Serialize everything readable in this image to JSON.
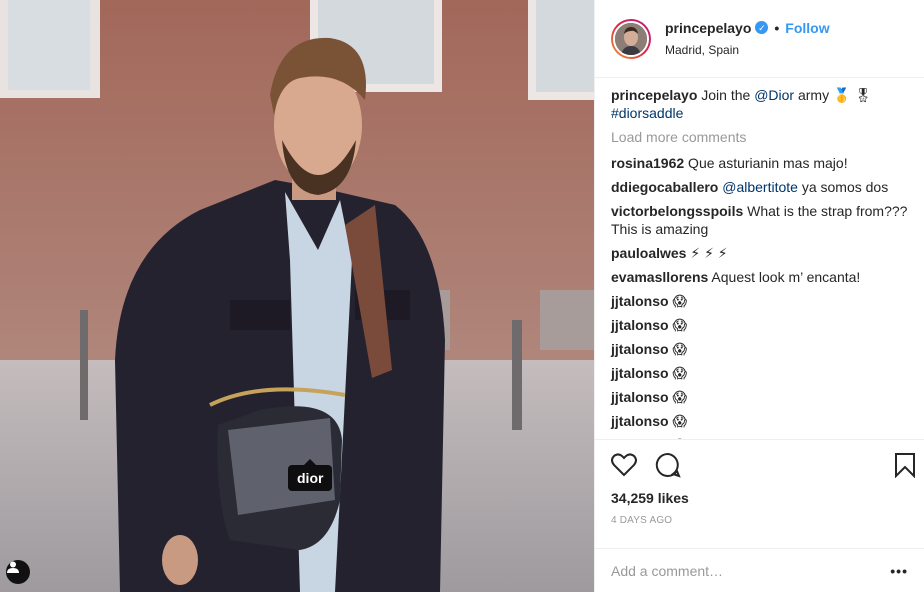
{
  "photo": {
    "tag_label": "dior"
  },
  "header": {
    "username": "princepelayo",
    "verified_mark": "✓",
    "separator": "•",
    "follow_label": "Follow",
    "location": "Madrid, Spain"
  },
  "caption": {
    "username": "princepelayo",
    "text_before": " Join the ",
    "mention": "@Dior",
    "text_after": " army 🥇 🎖",
    "hashtag": "#diorsaddle"
  },
  "load_more_label": "Load more comments",
  "comments": [
    {
      "user": "rosina1962",
      "text": " Que asturianin mas majo!"
    },
    {
      "user": "ddiegocaballero",
      "mention": " @albertitote",
      "text": " ya somos dos"
    },
    {
      "user": "victorbelongsspoils",
      "text": " What is the strap from??? This is amazing"
    },
    {
      "user": "pauloalwes",
      "text": " ⚡ ⚡ ⚡"
    },
    {
      "user": "evamasllorens",
      "text": " Aquest look m’ encanta!"
    },
    {
      "user": "jjtalonso",
      "text": " 😱"
    },
    {
      "user": "jjtalonso",
      "text": " 😱"
    },
    {
      "user": "jjtalonso",
      "text": " 😱"
    },
    {
      "user": "jjtalonso",
      "text": " 😱"
    },
    {
      "user": "jjtalonso",
      "text": " 😱"
    },
    {
      "user": "jjtalonso",
      "text": " 😱"
    },
    {
      "user": "jjtalonso",
      "text": " 😱"
    }
  ],
  "likes": "34,259 likes",
  "age": "4 DAYS AGO",
  "add_comment_placeholder": "Add a comment…",
  "more_label": "•••",
  "icons": {
    "like": "heart-icon",
    "comment": "comment-icon",
    "save": "bookmark-icon",
    "tagged": "user-icon"
  },
  "colors": {
    "accent": "#3897f0",
    "muted": "#999999",
    "text": "#262626"
  }
}
